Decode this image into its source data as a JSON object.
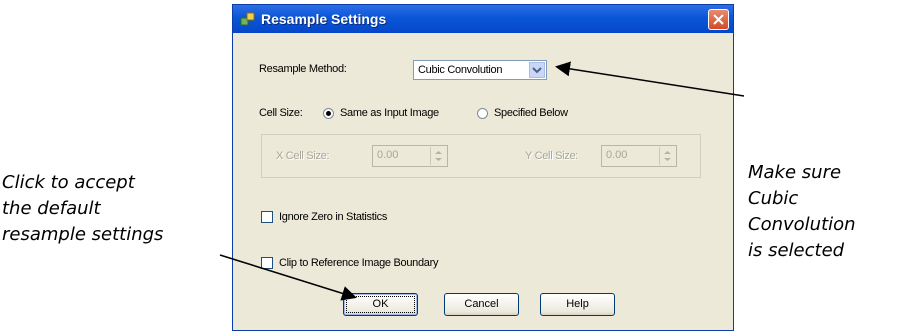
{
  "dialog": {
    "title": "Resample Settings",
    "resample_method_label": "Resample Method:",
    "resample_method_value": "Cubic Convolution",
    "cell_size_label": "Cell Size:",
    "cell_size_options": [
      "Same as Input Image",
      "Specified Below"
    ],
    "cell_size_selected": "Same as Input Image",
    "x_cell_size_label": "X Cell Size:",
    "x_cell_size_value": "0.00",
    "y_cell_size_label": "Y Cell Size:",
    "y_cell_size_value": "0.00",
    "ignore_zero_label": "Ignore Zero in Statistics",
    "ignore_zero_checked": false,
    "clip_label": "Clip to Reference Image Boundary",
    "clip_checked": false,
    "buttons": {
      "ok": "OK",
      "cancel": "Cancel",
      "help": "Help"
    }
  },
  "callouts": {
    "right": [
      "Make sure",
      "Cubic",
      "Convolution",
      "is selected"
    ],
    "left": [
      "Click to accept",
      "the default",
      "resample settings"
    ]
  }
}
